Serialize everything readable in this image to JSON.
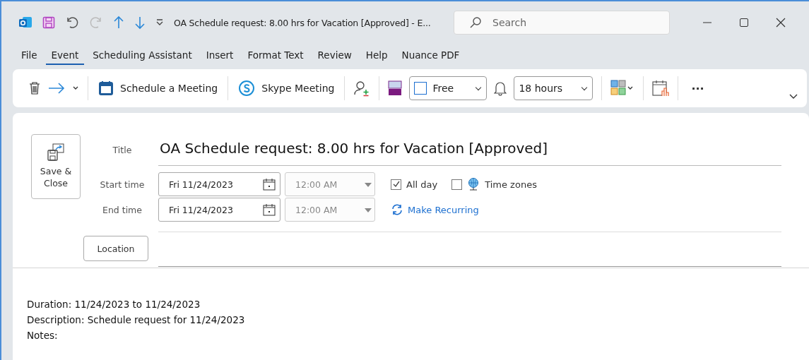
{
  "window": {
    "title": "OA Schedule request: 8.00 hrs for Vacation [Approved]  -  E..."
  },
  "search": {
    "placeholder": "Search"
  },
  "menu_tabs": [
    {
      "label": "File",
      "selected": false
    },
    {
      "label": "Event",
      "selected": true
    },
    {
      "label": "Scheduling Assistant",
      "selected": false
    },
    {
      "label": "Insert",
      "selected": false
    },
    {
      "label": "Format Text",
      "selected": false
    },
    {
      "label": "Review",
      "selected": false
    },
    {
      "label": "Help",
      "selected": false
    },
    {
      "label": "Nuance PDF",
      "selected": false
    }
  ],
  "ribbon": {
    "schedule_meeting": "Schedule a Meeting",
    "skype_meeting": "Skype Meeting",
    "show_as": "Free",
    "reminder": "18 hours",
    "more": "···"
  },
  "form": {
    "save_close": "Save & Close",
    "title_label": "Title",
    "title": "OA Schedule request: 8.00 hrs for Vacation [Approved]",
    "start_label": "Start time",
    "start_date": "Fri 11/24/2023",
    "start_time": "12:00 AM",
    "start_time_disabled": true,
    "end_label": "End time",
    "end_date": "Fri 11/24/2023",
    "end_time": "12:00 AM",
    "end_time_disabled": true,
    "all_day": {
      "label": "All day",
      "checked": true
    },
    "time_zones": {
      "label": "Time zones",
      "checked": false
    },
    "make_recurring": "Make Recurring",
    "location": "Location"
  },
  "body": [
    "Duration:  11/24/2023 to 11/24/2023",
    "Description: Schedule request for 11/24/2023",
    "Notes:"
  ]
}
